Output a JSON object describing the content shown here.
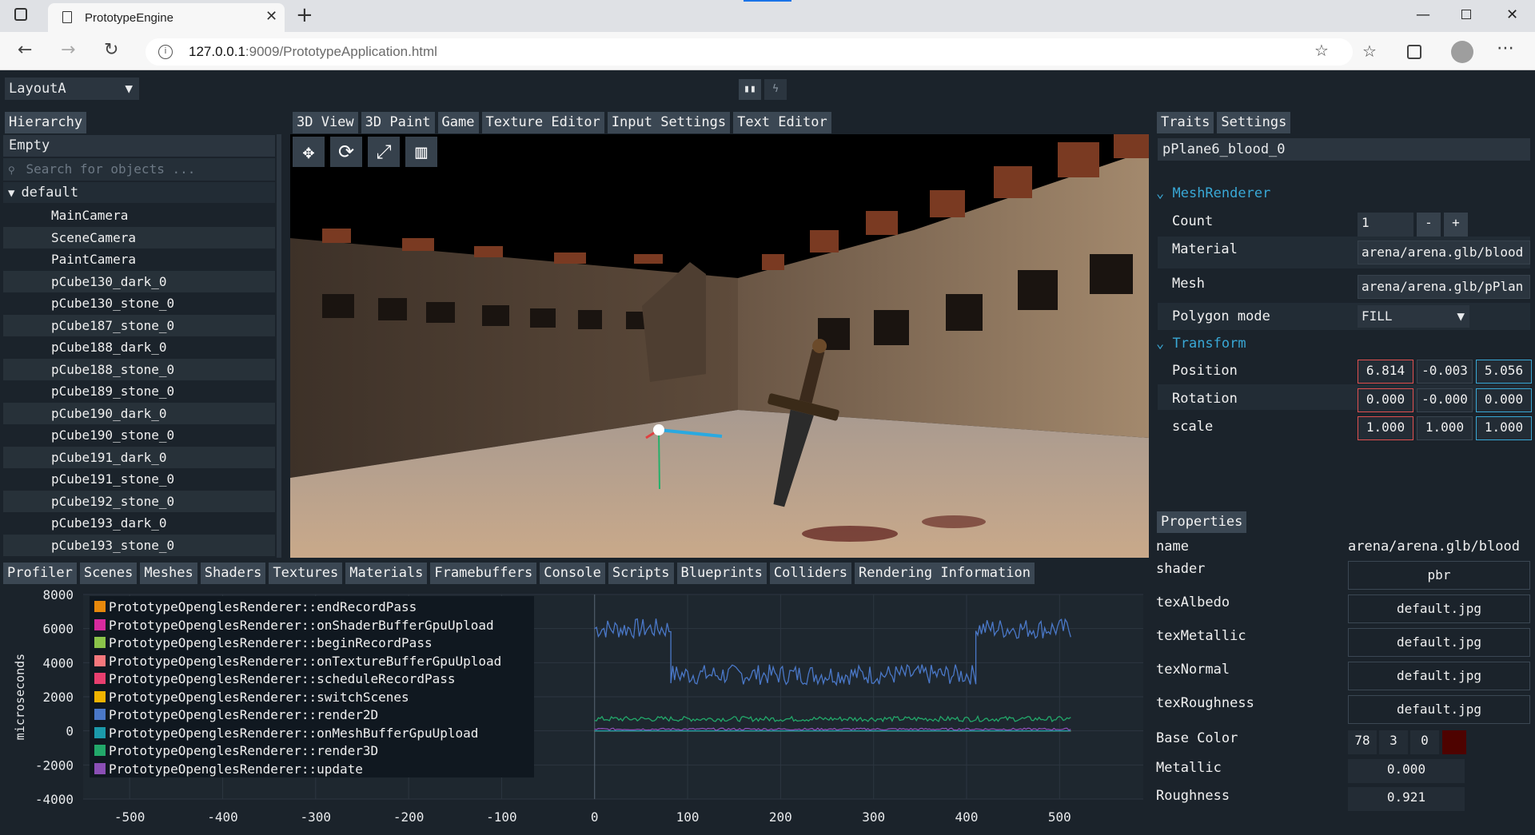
{
  "browser": {
    "tab_title": "PrototypeEngine",
    "url": "127.0.0.1:9009/PrototypeApplication.html",
    "url_host": "127.0.0.1",
    "url_rest": ":9009/PrototypeApplication.html"
  },
  "layout_select": "LayoutA",
  "viewport_tabs": [
    "3D View",
    "3D Paint",
    "Game",
    "Texture Editor",
    "Input Settings",
    "Text Editor"
  ],
  "hierarchy": {
    "tab": "Hierarchy",
    "empty_label": "Empty",
    "search_placeholder": "Search for objects ...",
    "root": "default",
    "items": [
      "MainCamera",
      "SceneCamera",
      "PaintCamera",
      "pCube130_dark_0",
      "pCube130_stone_0",
      "pCube187_stone_0",
      "pCube188_dark_0",
      "pCube188_stone_0",
      "pCube189_stone_0",
      "pCube190_dark_0",
      "pCube190_stone_0",
      "pCube191_dark_0",
      "pCube191_stone_0",
      "pCube192_stone_0",
      "pCube193_dark_0",
      "pCube193_stone_0"
    ]
  },
  "bottom_tabs": [
    "Profiler",
    "Scenes",
    "Meshes",
    "Shaders",
    "Textures",
    "Materials",
    "Framebuffers",
    "Console",
    "Scripts",
    "Blueprints",
    "Colliders",
    "Rendering Information"
  ],
  "traits": {
    "tabs": [
      "Traits",
      "Settings"
    ],
    "object_name": "pPlane6_blood_0",
    "mesh_renderer": {
      "header": "MeshRenderer",
      "count_label": "Count",
      "count": "1",
      "minus": "-",
      "plus": "+",
      "material_label": "Material",
      "material": "arena/arena.glb/blood",
      "mesh_label": "Mesh",
      "mesh": "arena/arena.glb/pPlan",
      "polygon_label": "Polygon mode",
      "polygon": "FILL"
    },
    "transform": {
      "header": "Transform",
      "position_label": "Position",
      "position": [
        "6.814",
        "-0.003",
        "5.056"
      ],
      "rotation_label": "Rotation",
      "rotation": [
        "0.000",
        "-0.000",
        "0.000"
      ],
      "scale_label": "scale",
      "scale": [
        "1.000",
        "1.000",
        "1.000"
      ]
    }
  },
  "properties": {
    "tab": "Properties",
    "name_label": "name",
    "name": "arena/arena.glb/blood",
    "shader_label": "shader",
    "shader": "pbr",
    "texAlbedo_label": "texAlbedo",
    "texAlbedo": "default.jpg",
    "texMetallic_label": "texMetallic",
    "texMetallic": "default.jpg",
    "texNormal_label": "texNormal",
    "texNormal": "default.jpg",
    "texRoughness_label": "texRoughness",
    "texRoughness": "default.jpg",
    "base_color_label": "Base Color",
    "base_color": [
      "78",
      "3",
      "0"
    ],
    "base_color_swatch": "#4e0300",
    "metallic_label": "Metallic",
    "metallic": "0.000",
    "roughness_label": "Roughness",
    "roughness": "0.921"
  },
  "chart_data": {
    "type": "line",
    "title": "",
    "xlabel": "",
    "ylabel": "microseconds",
    "xlim": [
      -550,
      590
    ],
    "ylim": [
      -4000,
      8000
    ],
    "x_ticks": [
      "-500",
      "-400",
      "-300",
      "-200",
      "-100",
      "0",
      "100",
      "200",
      "300",
      "400",
      "500"
    ],
    "y_ticks": [
      "8000",
      "6000",
      "4000",
      "2000",
      "0",
      "-2000",
      "-4000"
    ],
    "legend_position": "top-left",
    "series": [
      {
        "name": "PrototypeOpenglesRenderer::endRecordPass",
        "color": "#e8890c",
        "segments": [
          [
            0,
            0,
            512,
            0
          ]
        ]
      },
      {
        "name": "PrototypeOpenglesRenderer::onShaderBufferGpuUpload",
        "color": "#d72a9e",
        "segments": [
          [
            0,
            0,
            512,
            0
          ]
        ]
      },
      {
        "name": "PrototypeOpenglesRenderer::beginRecordPass",
        "color": "#8bc34a",
        "segments": [
          [
            0,
            0,
            512,
            0
          ]
        ]
      },
      {
        "name": "PrototypeOpenglesRenderer::onTextureBufferGpuUpload",
        "color": "#f4777c",
        "segments": [
          [
            0,
            0,
            512,
            0
          ]
        ]
      },
      {
        "name": "PrototypeOpenglesRenderer::scheduleRecordPass",
        "color": "#e83f6f",
        "segments": [
          [
            0,
            0,
            512,
            0
          ]
        ]
      },
      {
        "name": "PrototypeOpenglesRenderer::switchScenes",
        "color": "#f0b400",
        "segments": [
          [
            0,
            0,
            512,
            0
          ]
        ]
      },
      {
        "name": "PrototypeOpenglesRenderer::render2D",
        "color": "#4a78c8",
        "segments": [
          [
            0,
            6000,
            82,
            6000
          ],
          [
            82,
            3300,
            410,
            3300
          ],
          [
            410,
            6000,
            512,
            6000
          ]
        ],
        "noise": 600
      },
      {
        "name": "PrototypeOpenglesRenderer::onMeshBufferGpuUpload",
        "color": "#1b9aaa",
        "segments": [
          [
            0,
            0,
            512,
            0
          ]
        ]
      },
      {
        "name": "PrototypeOpenglesRenderer::render3D",
        "color": "#22a86a",
        "segments": [
          [
            0,
            700,
            512,
            700
          ]
        ],
        "noise": 150
      },
      {
        "name": "PrototypeOpenglesRenderer::update",
        "color": "#8a4fb5",
        "segments": [
          [
            0,
            100,
            512,
            100
          ]
        ],
        "noise": 60
      }
    ]
  }
}
